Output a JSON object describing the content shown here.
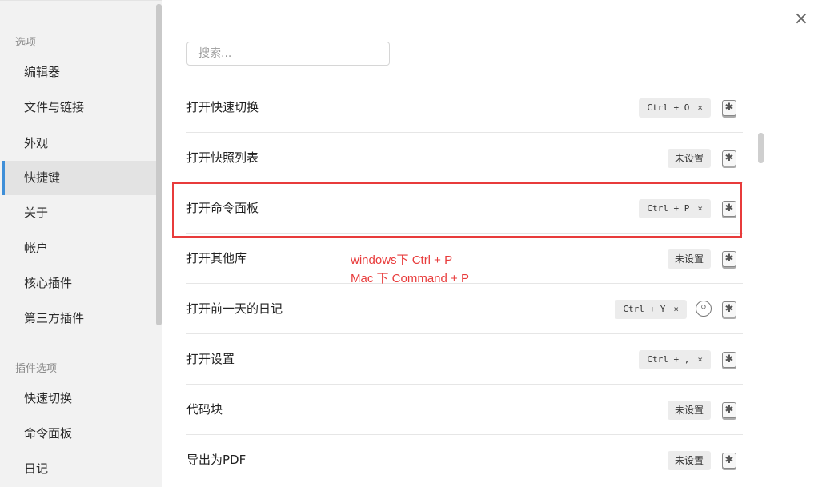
{
  "sidebar": {
    "section1": "选项",
    "items": [
      "编辑器",
      "文件与链接",
      "外观",
      "快捷键",
      "关于",
      "帐户",
      "核心插件",
      "第三方插件"
    ],
    "section2": "插件选项",
    "plugin_items": [
      "快速切换",
      "命令面板",
      "日记"
    ]
  },
  "main": {
    "close_icon": "×",
    "search_placeholder": "搜索...",
    "rows": [
      {
        "label": "打开快速切换",
        "hotkey": "Ctrl + O",
        "unset": ""
      },
      {
        "label": "打开快照列表",
        "hotkey": "",
        "unset": "未设置"
      },
      {
        "label": "打开命令面板",
        "hotkey": "Ctrl + P",
        "unset": ""
      },
      {
        "label": "打开其他库",
        "hotkey": "",
        "unset": "未设置"
      },
      {
        "label": "打开前一天的日记",
        "hotkey": "Ctrl + Y",
        "unset": ""
      },
      {
        "label": "打开设置",
        "hotkey": "Ctrl + ,",
        "unset": ""
      },
      {
        "label": "代码块",
        "hotkey": "",
        "unset": "未设置"
      },
      {
        "label": "导出为PDF",
        "hotkey": "",
        "unset": "未设置"
      }
    ],
    "remove_glyph": "×",
    "add_glyph": "✱",
    "restore_glyph": "↺"
  },
  "annotation": {
    "line1": "windows下 Ctrl + P",
    "line2": "Mac 下 Command + P",
    "color": "#e83b3b"
  }
}
